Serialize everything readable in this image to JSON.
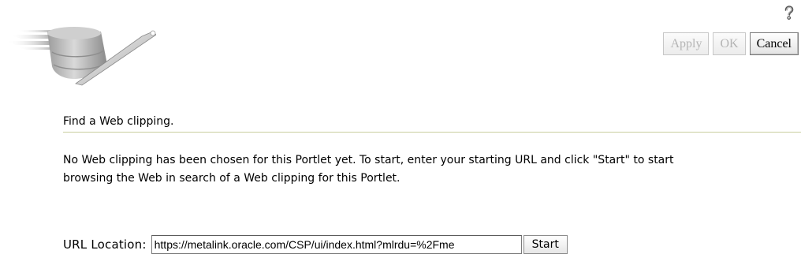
{
  "header": {
    "help_icon": "help-question-icon",
    "logo_icon": "database-wand-logo"
  },
  "toolbar": {
    "apply_label": "Apply",
    "ok_label": "OK",
    "cancel_label": "Cancel"
  },
  "section": {
    "title": "Find a Web clipping."
  },
  "instructions": {
    "line1": "No Web clipping has been chosen for this Portlet yet. To start, enter your starting URL and click \"Start\" to start",
    "line2": "browsing the Web in search of a Web clipping for this Portlet."
  },
  "url_form": {
    "label": "URL Location:",
    "value": "https://metalink.oracle.com/CSP/ui/index.html?mlrdu=%2Fme",
    "start_label": "Start"
  },
  "colors": {
    "section_rule": "#c9ce9e",
    "disabled_text": "#b4b4b4"
  }
}
